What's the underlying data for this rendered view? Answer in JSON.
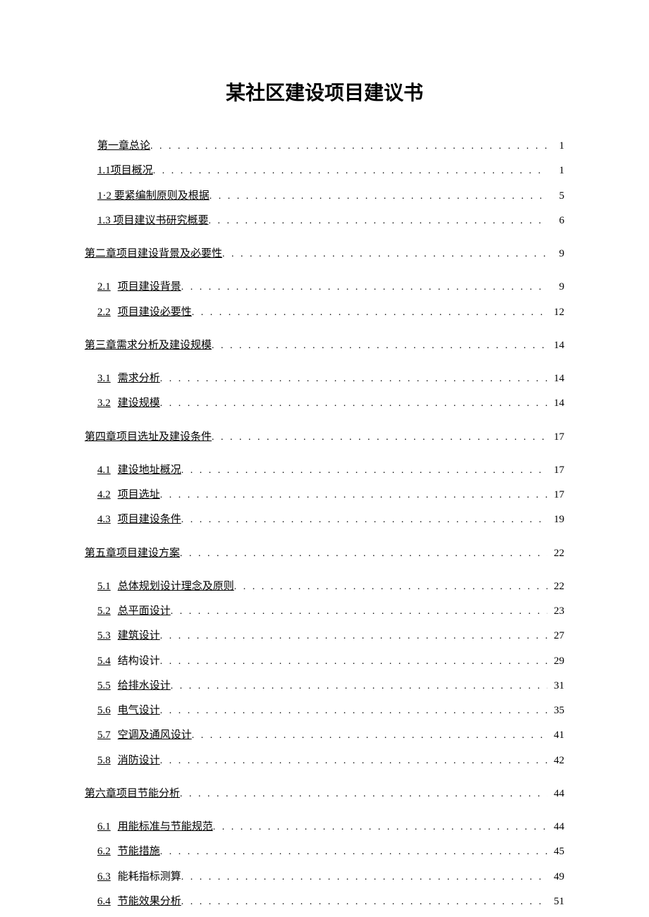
{
  "title": "某社区建设项目建议书",
  "toc": [
    {
      "level": "level-1",
      "num": "",
      "label": "第一章总论",
      "page": "1",
      "combined": true
    },
    {
      "level": "level-1",
      "num": "1.1",
      "label": "项目概况",
      "page": "1",
      "combined": true,
      "nospace": true
    },
    {
      "level": "level-1",
      "num": "1·2",
      "label": "要紧编制原则及根据",
      "page": "5",
      "combined": true
    },
    {
      "level": "level-1",
      "num": "1.3",
      "label": "项目建议书研究概要",
      "page": "6",
      "combined": true
    },
    {
      "spacer": true
    },
    {
      "level": "chapter",
      "num": "",
      "label": "第二章项目建设背景及必要性",
      "page": "9",
      "combined": true
    },
    {
      "spacer": true
    },
    {
      "level": "level-2",
      "num": "2.1",
      "label": "项目建设背景",
      "page": "9"
    },
    {
      "level": "level-2",
      "num": "2.2",
      "label": "项目建设必要性",
      "page": "12"
    },
    {
      "spacer": true
    },
    {
      "level": "chapter",
      "num": "",
      "label": "第三章需求分析及建设规模",
      "page": "14",
      "combined": true
    },
    {
      "spacer": true
    },
    {
      "level": "level-2",
      "num": "3.1",
      "label": "需求分析",
      "page": "14"
    },
    {
      "level": "level-2",
      "num": "3.2",
      "label": "建设规模",
      "page": "14"
    },
    {
      "spacer": true
    },
    {
      "level": "chapter",
      "num": "",
      "label": "第四章项目选址及建设条件",
      "page": "17",
      "combined": true
    },
    {
      "spacer": true
    },
    {
      "level": "level-2",
      "num": "4.1",
      "label": "建设地址概况",
      "page": "17"
    },
    {
      "level": "level-2",
      "num": "4.2",
      "label": "项目选址",
      "page": "17",
      "trailspace": true
    },
    {
      "level": "level-2",
      "num": "4.3",
      "label": "项目建设条件",
      "page": "19"
    },
    {
      "spacer": true
    },
    {
      "level": "chapter",
      "num": "",
      "label": "第五章项目建设方案",
      "page": "22",
      "combined": true
    },
    {
      "spacer": true
    },
    {
      "level": "level-2",
      "num": "5.1",
      "label": "总体规划设计理念及原则",
      "page": "22"
    },
    {
      "level": "level-2",
      "num": "5.2",
      "label": "总平面设计",
      "page": "23"
    },
    {
      "level": "level-2",
      "num": "5.3",
      "label": "建筑设计",
      "page": "27"
    },
    {
      "level": "level-2",
      "num": "5.4",
      "label": "结构设计",
      "page": "29",
      "noUnderlineLabel": true
    },
    {
      "level": "level-2",
      "num": "5.5",
      "label": "给排水设计",
      "page": "31"
    },
    {
      "level": "level-2",
      "num": "5.6",
      "label": "电气设计",
      "page": "35"
    },
    {
      "level": "level-2",
      "num": "5.7",
      "label": "空调及通风设计",
      "page": "41"
    },
    {
      "level": "level-2",
      "num": "5.8",
      "label": "消防设计",
      "page": "42"
    },
    {
      "spacer": true
    },
    {
      "level": "chapter",
      "num": "",
      "label": "第六章项目节能分析",
      "page": "44",
      "combined": true
    },
    {
      "spacer": true
    },
    {
      "level": "level-2",
      "num": "6.1",
      "label": "用能标准与节能规范",
      "page": "44"
    },
    {
      "level": "level-2",
      "num": "6.2",
      "label": "节能措施",
      "page": "45"
    },
    {
      "level": "level-2",
      "num": "6.3",
      "label": "能耗指标测算",
      "page": "49",
      "noUnderlineLabel": true
    },
    {
      "level": "level-2",
      "num": "6.4",
      "label": "节能效果分析",
      "page": "51"
    }
  ]
}
